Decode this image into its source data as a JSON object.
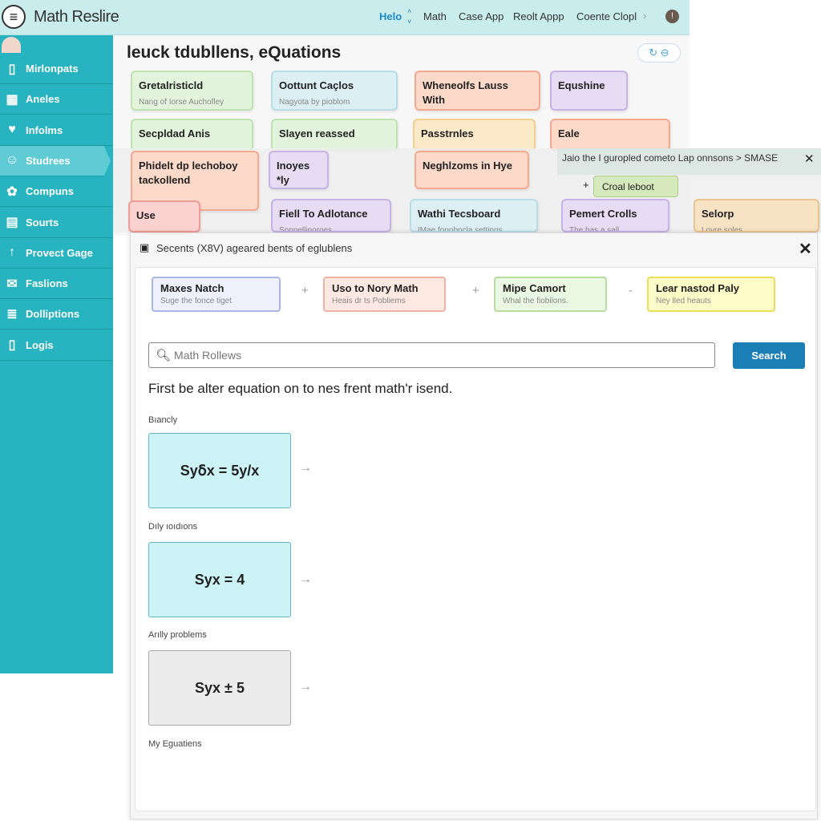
{
  "topbar": {
    "app_title": "Math Reslire",
    "nav": [
      "Helo",
      "Math",
      "Case App",
      "Reolt Appp",
      "Coente Clopl"
    ],
    "menu_icon": "hamburger-icon",
    "more_icon": "chevron-right-icon",
    "info_icon": "info-icon",
    "accent": "#1e88c8"
  },
  "sidebar": {
    "color": "#27b3bf",
    "items": [
      {
        "label": "Mirlonpats",
        "icon": "phone-icon"
      },
      {
        "label": "Aneles",
        "icon": "calendar-icon"
      },
      {
        "label": "Infolms",
        "icon": "bird-icon"
      },
      {
        "label": "Studrees",
        "icon": "student-icon"
      },
      {
        "label": "Compuns",
        "icon": "globe-icon"
      },
      {
        "label": "Sourts",
        "icon": "briefcase-icon"
      },
      {
        "label": "Provect Gage",
        "icon": "arrow-up-icon"
      },
      {
        "label": "Faslions",
        "icon": "envelope-icon"
      },
      {
        "label": "Dolliptions",
        "icon": "list-icon"
      },
      {
        "label": "Logis",
        "icon": "mobile-icon"
      }
    ],
    "active_index": 3
  },
  "back_panel": {
    "title": "leuck tdubllens, eQuations",
    "cards": [
      {
        "title": "Gretalristicld",
        "sub": "Nang of Iorse Auchofley",
        "color": "green"
      },
      {
        "title": "Oottunt Caçlos",
        "sub": "Nagyota by pioblom",
        "color": "blue"
      },
      {
        "title": "Wheneolfs Lauss With",
        "sub": "",
        "color": "salmon"
      },
      {
        "title": "Equshine",
        "sub": "",
        "color": "purple"
      },
      {
        "title": "Secpldad Anis",
        "sub": "",
        "color": "green"
      },
      {
        "title": "Slayen reassed",
        "sub": "",
        "color": "green"
      },
      {
        "title": "Passtrnles",
        "sub": "",
        "color": "yellow"
      },
      {
        "title": "Eale",
        "sub": "",
        "color": "salmon"
      }
    ]
  },
  "mid_panel": {
    "cards": [
      {
        "title": "Phidelt dp lechoboy tackollend",
        "sub": "",
        "color": "salmon"
      },
      {
        "title": "Inoyes *ly",
        "sub": "",
        "color": "purple"
      },
      {
        "title": "Neghlzoms in Hye",
        "sub": "",
        "color": "salmon"
      },
      {
        "title": "Use",
        "sub": "",
        "color": "red"
      },
      {
        "title": "Fiell To Adlotance",
        "sub": "Sonnellinoroes",
        "color": "purple"
      },
      {
        "title": "Wathi Tecsboard",
        "sub": "IMae fonobncla settings",
        "color": "blue"
      },
      {
        "title": "Pemert Crolls",
        "sub": "The has a sall",
        "color": "purple"
      },
      {
        "title": "Selorp",
        "sub": "Lovre soles",
        "color": "orange"
      }
    ]
  },
  "overlay": {
    "title": "Jaio the I guropled cometo Lap onnsons > SMASE",
    "button": "Croal leboot"
  },
  "dialog": {
    "title": "Secents (X8V) ageared bents of eglublens",
    "chips": [
      {
        "title": "Maxes Natch",
        "sub": "Suge the fonce tiget",
        "bg": "#eef0fc",
        "border": "#a9b6e6"
      },
      {
        "title": "Uso to Nory Math",
        "sub": "Heais dr ts Pobliems",
        "bg": "#fde8e2",
        "border": "#f0b3a3"
      },
      {
        "title": "Mipe Camort",
        "sub": "Whal the fiobilons.",
        "bg": "#eaf7e2",
        "border": "#b6dca0"
      },
      {
        "title": "Lear nastod Paly",
        "sub": "Ney lled heauts",
        "bg": "#fdfbc8",
        "border": "#e9df5a"
      }
    ],
    "separators": [
      "+",
      "+",
      "-"
    ],
    "search": {
      "placeholder": "Math Rollews",
      "button": "Search"
    },
    "prompt": "First be alter equation on to nes frent math'r isend.",
    "sections": [
      {
        "label": "Bıancly",
        "equation": "Syẟx = 5y/x"
      },
      {
        "label": "Dıly ıoıdıons",
        "equation": "Syx = 4"
      },
      {
        "label": "Arılly problems",
        "equation": "Syx ± 5"
      }
    ],
    "footer_label": "My Eguatiens"
  }
}
